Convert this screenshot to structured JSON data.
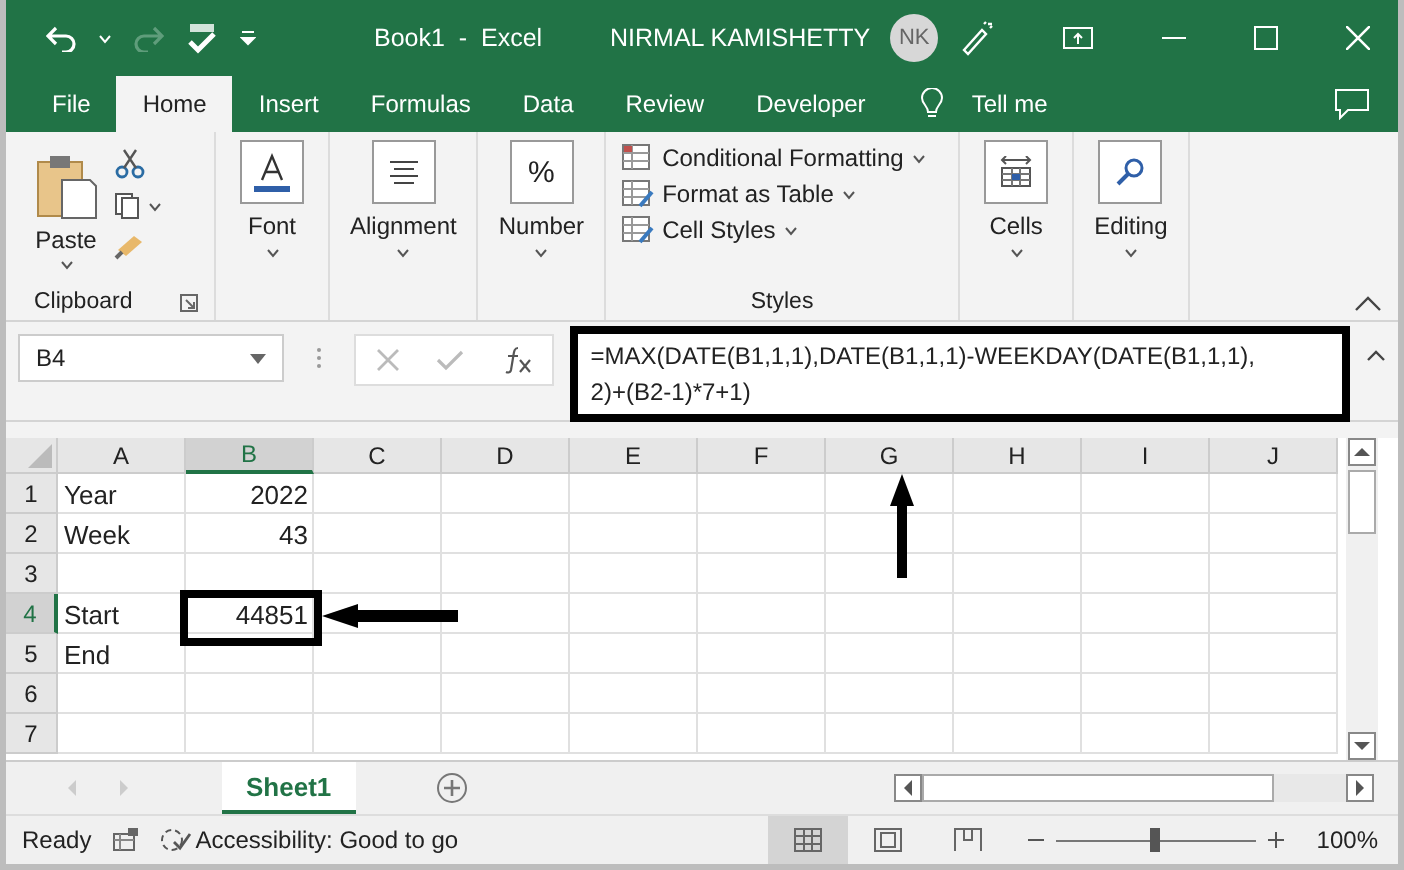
{
  "title_bar": {
    "document_title": "Book1  -  Excel",
    "user_name": "NIRMAL KAMISHETTY",
    "avatar_initials": "NK",
    "redo_disabled": true
  },
  "tabs": [
    {
      "label": "File",
      "selected": false
    },
    {
      "label": "Home",
      "selected": true
    },
    {
      "label": "Insert",
      "selected": false
    },
    {
      "label": "Formulas",
      "selected": false
    },
    {
      "label": "Data",
      "selected": false
    },
    {
      "label": "Review",
      "selected": false
    },
    {
      "label": "Developer",
      "selected": false
    }
  ],
  "tell_me": "Tell me",
  "ribbon": {
    "clipboard": {
      "paste": "Paste",
      "label": "Clipboard"
    },
    "big_buttons": [
      {
        "label": "Font",
        "kind": "font"
      },
      {
        "label": "Alignment",
        "kind": "alignment"
      },
      {
        "label": "Number",
        "kind": "number",
        "symbol": "%"
      }
    ],
    "styles": {
      "items": [
        "Conditional Formatting",
        "Format as Table",
        "Cell Styles"
      ],
      "label": "Styles"
    },
    "right_buttons": [
      {
        "label": "Cells",
        "kind": "cells"
      },
      {
        "label": "Editing",
        "kind": "editing"
      }
    ]
  },
  "formula_bar": {
    "name_box": "B4",
    "formula_lines": [
      "=MAX(DATE(B1,1,1),DATE(B1,1,1)-WEEKDAY(DATE(B1,1,1),",
      "2)+(B2-1)*7+1)"
    ]
  },
  "grid": {
    "columns": [
      {
        "label": "A",
        "selected": false
      },
      {
        "label": "B",
        "selected": true
      },
      {
        "label": "C",
        "selected": false
      },
      {
        "label": "D",
        "selected": false
      },
      {
        "label": "E",
        "selected": false
      },
      {
        "label": "F",
        "selected": false
      },
      {
        "label": "G",
        "selected": false
      },
      {
        "label": "H",
        "selected": false
      },
      {
        "label": "I",
        "selected": false
      },
      {
        "label": "J",
        "selected": false
      }
    ],
    "rows": [
      {
        "number": "1",
        "selected": false,
        "cells": [
          "Year",
          "2022"
        ]
      },
      {
        "number": "2",
        "selected": false,
        "cells": [
          "Week",
          "43"
        ]
      },
      {
        "number": "3",
        "selected": false,
        "cells": [
          "",
          ""
        ]
      },
      {
        "number": "4",
        "selected": true,
        "cells": [
          "Start",
          "44851"
        ]
      },
      {
        "number": "5",
        "selected": false,
        "cells": [
          "End",
          ""
        ]
      },
      {
        "number": "6",
        "selected": false,
        "cells": [
          "",
          ""
        ]
      },
      {
        "number": "7",
        "selected": false,
        "cells": [
          "",
          ""
        ]
      }
    ]
  },
  "sheets": [
    {
      "label": "Sheet1",
      "selected": true
    }
  ],
  "status_bar": {
    "mode": "Ready",
    "accessibility": "Accessibility: Good to go",
    "views": [
      {
        "kind": "normal",
        "selected": true
      },
      {
        "kind": "page-layout",
        "selected": false
      },
      {
        "kind": "page-break",
        "selected": false
      }
    ],
    "zoom": {
      "level": 0.5,
      "reading": "100%"
    }
  }
}
